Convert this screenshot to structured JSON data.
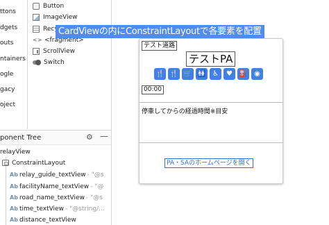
{
  "palette": {
    "categories": [
      "ttons",
      "dgets",
      "outs",
      "ntainers",
      "ogle",
      "gacy",
      "oject"
    ],
    "items": [
      {
        "label": "Button",
        "icon": "button-icon"
      },
      {
        "label": "ImageView",
        "icon": "imageview-icon"
      },
      {
        "label": "Recy",
        "icon": "recyclerview-icon"
      },
      {
        "label": "<fragment>",
        "icon": "fragment-icon"
      },
      {
        "label": "ScrollView",
        "icon": "scrollview-icon"
      },
      {
        "label": "Switch",
        "icon": "switch-icon"
      }
    ]
  },
  "tree": {
    "title": "ponent Tree",
    "gear_glyph": "⚙",
    "minimize_glyph": "—",
    "rows": [
      {
        "label": "relayView",
        "hint": ""
      },
      {
        "label": "ConstraintLayout",
        "hint": ""
      },
      {
        "label": "relay_guide_textView",
        "hint": "- \"@s"
      },
      {
        "label": "facilityName_textView",
        "hint": "- \"@"
      },
      {
        "label": "road_name_textView",
        "hint": "- \"@s"
      },
      {
        "label": "time_textView",
        "hint": "- \"@string/..."
      },
      {
        "label": "distance_textView",
        "hint": ""
      }
    ],
    "ab_label": "Ab"
  },
  "annotation": {
    "text": "CardViewの内にConstraintLayoutで各要素を配置"
  },
  "card": {
    "relay_guide": "テスト道路",
    "facility_name": "テストPA",
    "facility_icons": [
      {
        "name": "restaurant-icon",
        "glyph": "🍴"
      },
      {
        "name": "snack-icon",
        "glyph": "🍴"
      },
      {
        "name": "shop-icon",
        "glyph": "🛒"
      },
      {
        "name": "restroom-icon",
        "glyph": "🚻"
      },
      {
        "name": "accessible-icon",
        "glyph": "♿"
      },
      {
        "name": "hospitality-icon",
        "glyph": "♥"
      },
      {
        "name": "gas-station-icon",
        "glyph": "⛽"
      },
      {
        "name": "info-icon",
        "glyph": "◉"
      }
    ],
    "time": "00:00",
    "distance_label": "停車してからの経過時間※目安",
    "open_button": "PA・SAのホームページを開く"
  },
  "colors": {
    "accent": "#3f82e6",
    "banner": "#4e8cf0",
    "link": "#2f6fd8"
  }
}
